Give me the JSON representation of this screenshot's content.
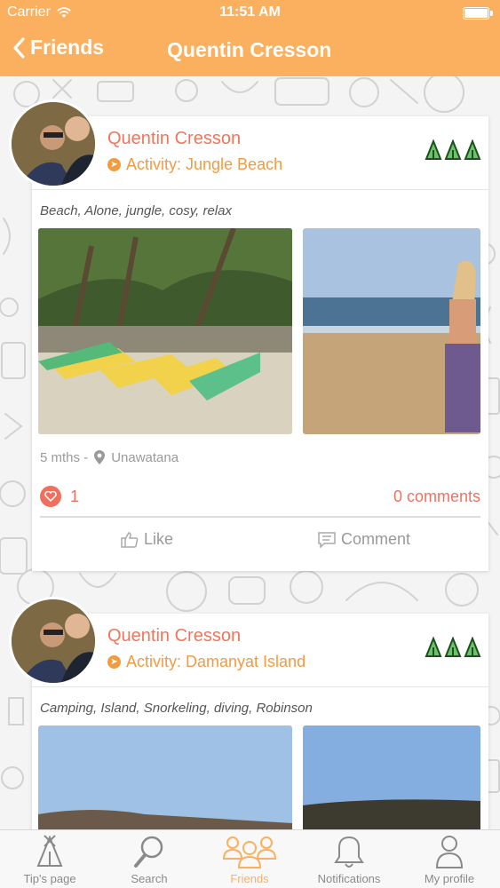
{
  "status_bar": {
    "carrier": "Carrier",
    "time": "11:51 AM"
  },
  "nav": {
    "back_label": "Friends",
    "title": "Quentin Cresson"
  },
  "colors": {
    "header": "#fbb05f",
    "accent_red": "#f07060",
    "accent_orange": "#f59a3e",
    "tent_green": "#2e7d32"
  },
  "posts": [
    {
      "author": "Quentin Cresson",
      "activity": "Activity: Jungle Beach",
      "tags": "Beach, Alone, jungle, cosy, relax",
      "age": "5 mths -",
      "location": "Unawatana",
      "likes": "1",
      "comments": "0 comments",
      "like_label": "Like",
      "comment_label": "Comment"
    },
    {
      "author": "Quentin Cresson",
      "activity": "Activity: Damanyat Island",
      "tags": "Camping, Island, Snorkeling, diving, Robinson"
    }
  ],
  "tabs": [
    {
      "label": "Tip's page",
      "icon": "tent-icon"
    },
    {
      "label": "Search",
      "icon": "search-icon"
    },
    {
      "label": "Friends",
      "icon": "friends-icon",
      "active": true
    },
    {
      "label": "Notifications",
      "icon": "bell-icon"
    },
    {
      "label": "My profile",
      "icon": "profile-icon"
    }
  ]
}
